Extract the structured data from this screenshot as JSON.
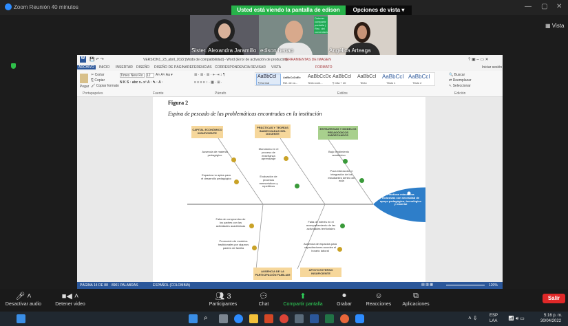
{
  "zoom": {
    "window_title": "Zoom Reunión 40 minutos",
    "share_banner": "Usted está viendo la pantalla de edison henao",
    "view_options": "Opciones de vista",
    "vista_button": "Vista",
    "participants": [
      {
        "name": "Sister. Alexandra Jaramillo"
      },
      {
        "name": "edison henao"
      },
      {
        "name": "Angélica Arteaga"
      }
    ],
    "overlay_text": "Detener compartir pantalla | Rec. del comentario"
  },
  "word": {
    "title": "VERSION1_23_abril_2022 [Modo de compatibilidad] - Word (Error de activación de productos)",
    "contextual_tab": "HERRAMIENTAS DE IMAGEN",
    "signin": "Iniciar sesión",
    "tabs": [
      "ARCHIVO",
      "INICIO",
      "INSERTAR",
      "DISEÑO",
      "DISEÑO DE PÁGINA",
      "REFERENCIAS",
      "CORRESPONDENCIA",
      "REVISAR",
      "VISTA",
      "FORMATO"
    ],
    "clipboard": {
      "cut": "Cortar",
      "copy": "Copiar",
      "paste": "Pegar",
      "format_painter": "Copiar formato"
    },
    "font_name": "Times New Ro",
    "font_size": "12",
    "styles": [
      {
        "sample": "AaBbCcI",
        "name": "¶ Normal"
      },
      {
        "sample": "AaBbCcDdEe",
        "name": "Rel. de co..."
      },
      {
        "sample": "AaBbCcDc",
        "name": "Texto com..."
      },
      {
        "sample": "AaBbCcI",
        "name": "¶ Cita + 40"
      },
      {
        "sample": "AaBbCcI",
        "name": "Texto"
      },
      {
        "sample": "AaBbCcI",
        "name": "Título 1"
      },
      {
        "sample": "AaBbCcI",
        "name": "Título 2"
      }
    ],
    "editing": [
      "Buscar",
      "Reemplazar",
      "Seleccionar"
    ],
    "groups": [
      "Portapapeles",
      "Fuente",
      "Párrafo",
      "Estilos",
      "Edición"
    ],
    "status": [
      "PÁGINA 14 DE 88",
      "8901 PALABRAS",
      "ESPAÑOL (COLOMBIA)"
    ],
    "zoom_level": "120%"
  },
  "figure": {
    "caption": "Figura 2",
    "title": "Espina de pescado de las problemáticas encontradas en la institución",
    "head_text": "Prácticas educativas inclusivas con necesidad de apoyo pedagógico, tecnológico y material",
    "categories": [
      "CAPITAL ECONÓMICO INSUFICIENTE",
      "PRÁCTICAS Y TEORÍAS INADECUADAS DEL DOCENTE",
      "ESTRATEGIAS Y MODELOS PEDAGÓGICOS INADECUADOS",
      "AUSENCIA DE LA PARTICIPACIÓN FAMILIAR",
      "APOYO EXTERNO INSUFICIENTE"
    ],
    "causes": [
      "Ausencia de material pedagógico",
      "Espacios no aptos para el desarrollo pedagógico",
      "Monotonía en el proceso de enseñanza aprendizaje",
      "Evaluación de procesos memorísticos y repetitivos",
      "Bajo rendimiento académico",
      "Poca interacción e integración de los estudiantes dentro del aula",
      "Falta de compromiso de los padres con las actividades académicas",
      "Promoción de modelos tradicionales por algunos padres de familia",
      "Falta de interés en el acompañamiento de las actividades territoriales",
      "Ausencia de espacios para capacitaciones acordes al horario laboral"
    ],
    "colors": {
      "orange_box": "#f6d79b",
      "green_box": "#a8d08d",
      "head": "#2e7ec9",
      "green_dot": "#3a9a3a",
      "gold_dot": "#c9a227"
    }
  },
  "toolbar": {
    "items": [
      "Desactivar audio",
      "Detener video",
      "Participantes",
      "Chat",
      "Compartir pantalla",
      "Grabar",
      "Reacciones",
      "Aplicaciones"
    ],
    "participant_count": "3",
    "leave": "Salir"
  },
  "taskbar": {
    "lang": "ESP",
    "region": "LAA",
    "time": "5:16 p. m.",
    "date": "30/04/2022"
  }
}
